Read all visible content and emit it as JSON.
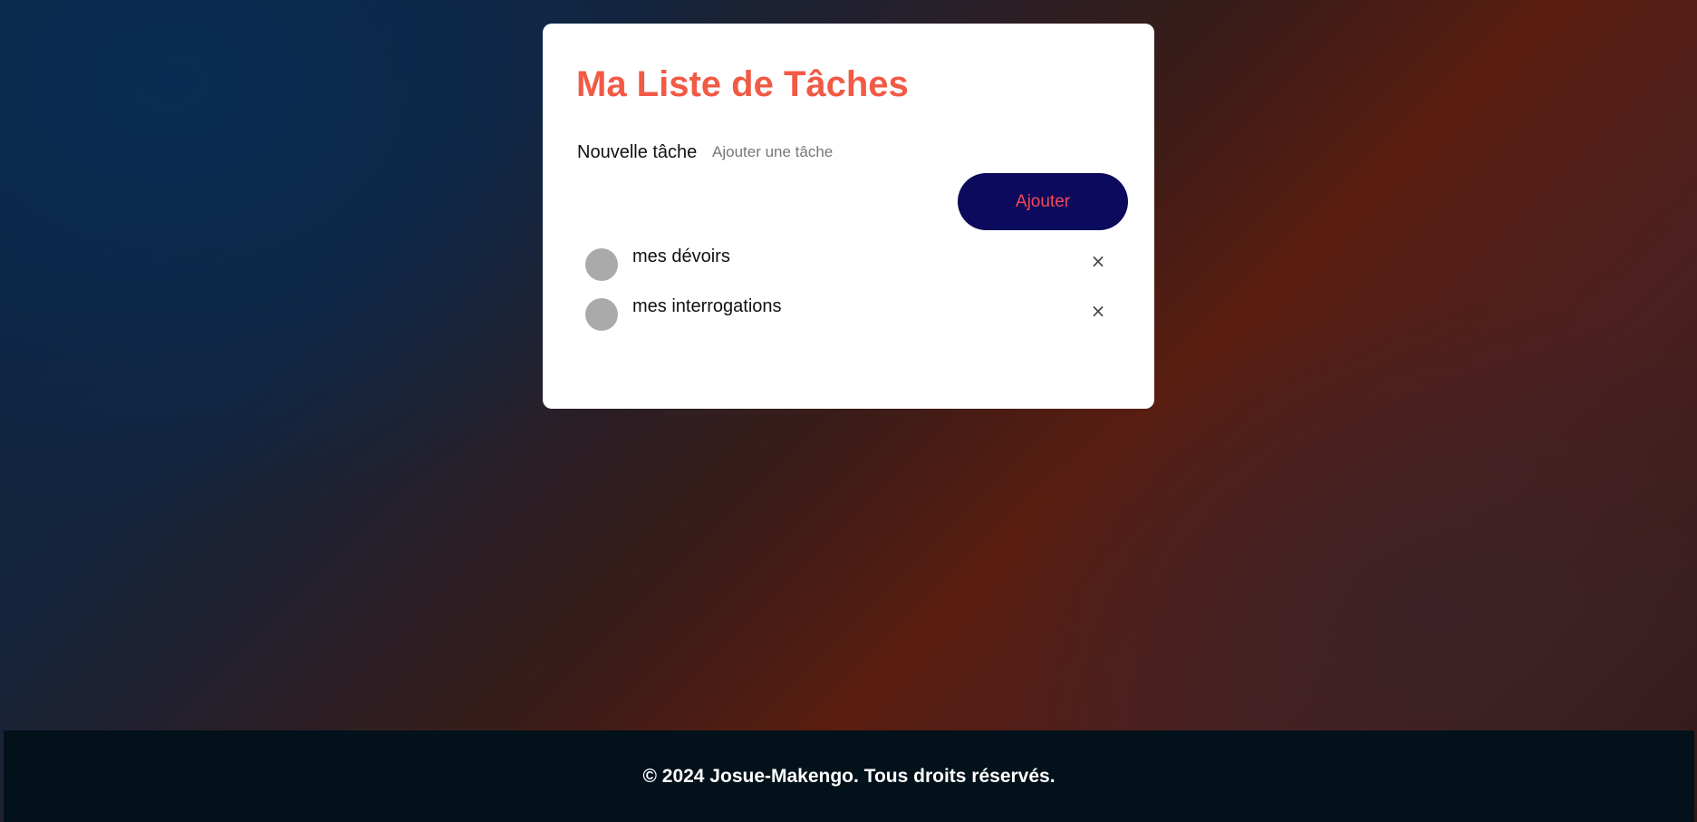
{
  "app": {
    "title": "Ma Liste de Tâches"
  },
  "form": {
    "label": "Nouvelle tâche",
    "input_value": "",
    "placeholder": "Ajouter une tâche",
    "add_button_label": "Ajouter"
  },
  "tasks": [
    {
      "text": "mes dévoirs",
      "completed": false,
      "delete_icon": "×"
    },
    {
      "text": "mes interrogations",
      "completed": false,
      "delete_icon": "×"
    }
  ],
  "footer": {
    "text": "© 2024 Josue-Makengo. Tous droits réservés."
  },
  "colors": {
    "title": "#f15a45",
    "button_bg": "#0b0a5c",
    "button_text": "#f04b55",
    "checkbox": "#aaaaaa",
    "footer_bg": "#03111a"
  },
  "icons": {
    "checkbox": "circle-checkbox-icon",
    "delete": "close-icon"
  }
}
